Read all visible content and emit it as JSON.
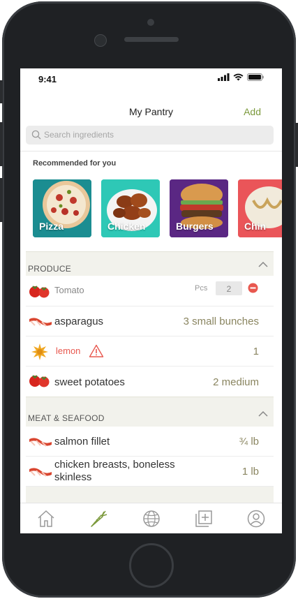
{
  "status": {
    "time": "9:41"
  },
  "nav": {
    "title": "My Pantry",
    "add_label": "Add"
  },
  "search": {
    "placeholder": "Search ingredients"
  },
  "recommended": {
    "title": "Recommended for you",
    "cards": [
      {
        "label": "Pizza"
      },
      {
        "label": "Chicken"
      },
      {
        "label": "Burgers"
      },
      {
        "label": "Chin"
      }
    ]
  },
  "sections": {
    "produce": {
      "title": "PRODUCE",
      "items": [
        {
          "name": "Tomato",
          "unit": "Pcs",
          "qty": "2"
        },
        {
          "name": "asparagus",
          "qty": "3 small bunches"
        },
        {
          "name": "lemon",
          "qty": "1"
        },
        {
          "name": "sweet potatoes",
          "qty": "2 medium"
        }
      ]
    },
    "meat": {
      "title": "MEAT & SEAFOOD",
      "items": [
        {
          "name": "salmon fillet",
          "qty": "¾ lb"
        },
        {
          "name": "chicken breasts, boneless skinless",
          "qty": "1 lb"
        }
      ]
    }
  },
  "colors": {
    "accent": "#7c9a3d",
    "warning": "#e8584f",
    "qty": "#8a8560"
  },
  "tabs": [
    "home-icon",
    "carrot-icon",
    "globe-icon",
    "add-collection-icon",
    "profile-icon"
  ]
}
